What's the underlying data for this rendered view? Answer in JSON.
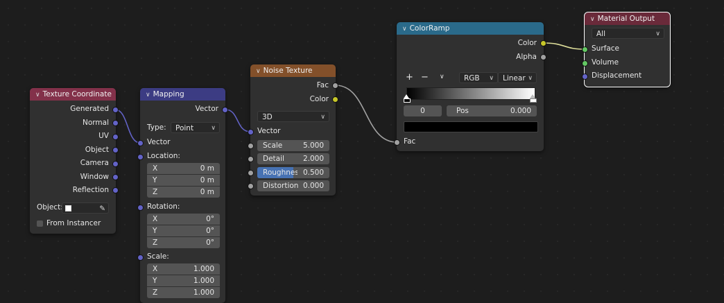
{
  "nodes": {
    "texture_coordinate": {
      "title": "Texture Coordinate",
      "outputs": [
        "Generated",
        "Normal",
        "UV",
        "Object",
        "Camera",
        "Window",
        "Reflection"
      ],
      "object_label": "Object:",
      "from_instancer_label": "From Instancer",
      "header_color": "#83314a"
    },
    "mapping": {
      "title": "Mapping",
      "output": "Vector",
      "type_label": "Type:",
      "type_value": "Point",
      "vector_input": "Vector",
      "location_label": "Location:",
      "location": [
        {
          "axis": "X",
          "value": "0 m"
        },
        {
          "axis": "Y",
          "value": "0 m"
        },
        {
          "axis": "Z",
          "value": "0 m"
        }
      ],
      "rotation_label": "Rotation:",
      "rotation": [
        {
          "axis": "X",
          "value": "0°"
        },
        {
          "axis": "Y",
          "value": "0°"
        },
        {
          "axis": "Z",
          "value": "0°"
        }
      ],
      "scale_label": "Scale:",
      "scale": [
        {
          "axis": "X",
          "value": "1.000"
        },
        {
          "axis": "Y",
          "value": "1.000"
        },
        {
          "axis": "Z",
          "value": "1.000"
        }
      ],
      "header_color": "#3c3c83"
    },
    "noise_texture": {
      "title": "Noise Texture",
      "outputs": [
        "Fac",
        "Color"
      ],
      "dimension": "3D",
      "vector_input": "Vector",
      "fields": [
        {
          "label": "Scale",
          "value": "5.000"
        },
        {
          "label": "Detail",
          "value": "2.000"
        },
        {
          "label": "Roughness",
          "value": "0.500",
          "fill": 0.5
        },
        {
          "label": "Distortion",
          "value": "0.000"
        }
      ],
      "header_color": "#83502a"
    },
    "color_ramp": {
      "title": "ColorRamp",
      "outputs": [
        "Color",
        "Alpha"
      ],
      "add": "+",
      "remove": "−",
      "color_mode": "RGB",
      "interpolation": "Linear",
      "index": "0",
      "pos_label": "Pos",
      "pos_value": "0.000",
      "selected_color": "#000000",
      "fac_input": "Fac",
      "header_color": "#2a6a8a"
    },
    "material_output": {
      "title": "Material Output",
      "target": "All",
      "inputs": [
        "Surface",
        "Volume",
        "Displacement"
      ],
      "header_color": "#6a2a3a"
    }
  }
}
